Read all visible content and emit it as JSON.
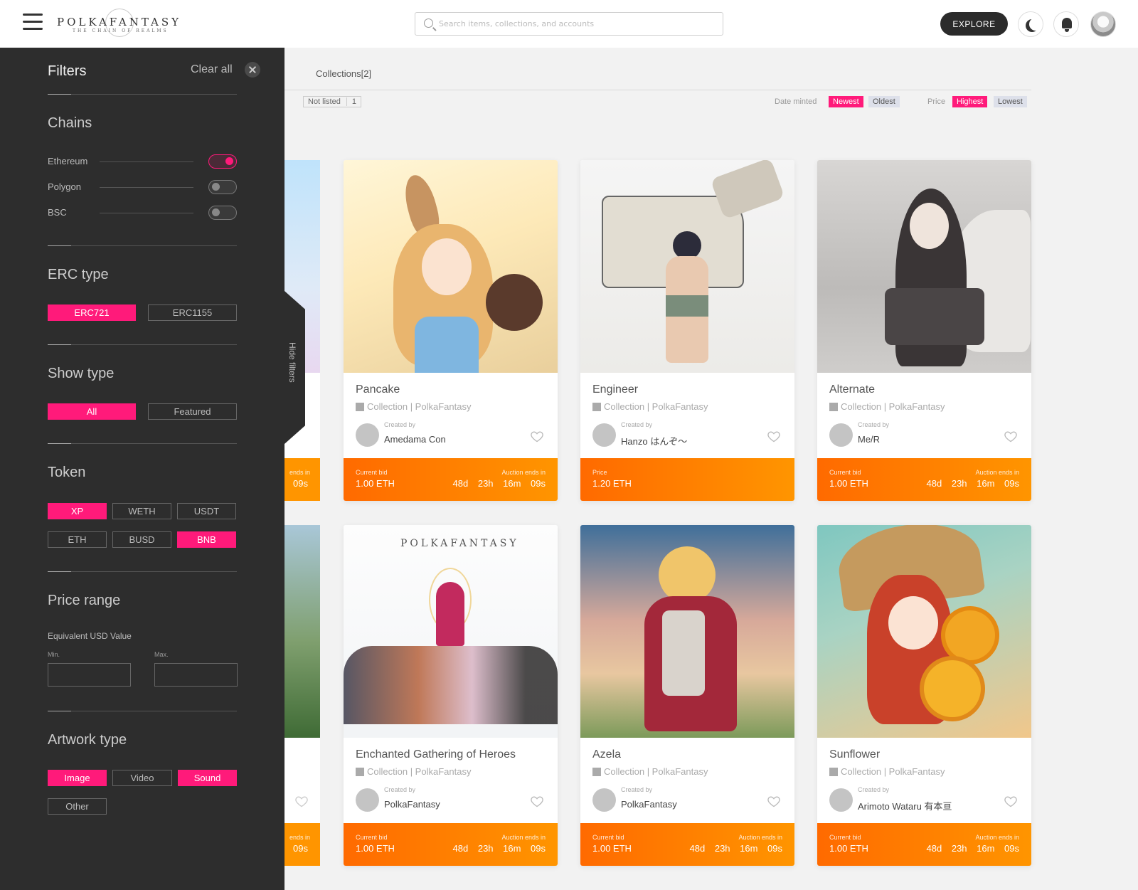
{
  "header": {
    "logo_main": "POLKAFANTASY",
    "logo_sub": "THE CHAIN OF REALMS",
    "search_placeholder": "Search items, collections, and accounts",
    "explore_label": "EXPLORE"
  },
  "sidebar": {
    "title": "Filters",
    "clear_all": "Clear all",
    "hide_filters": "Hide filters",
    "chains": {
      "title": "Chains",
      "items": [
        {
          "label": "Ethereum",
          "on": true
        },
        {
          "label": "Polygon",
          "on": false
        },
        {
          "label": "BSC",
          "on": false
        }
      ]
    },
    "erc": {
      "title": "ERC type",
      "options": [
        "ERC721",
        "ERC1155"
      ],
      "selected": "ERC721"
    },
    "show": {
      "title": "Show type",
      "options": [
        "All",
        "Featured"
      ],
      "selected": "All"
    },
    "token": {
      "title": "Token",
      "options": [
        "XP",
        "WETH",
        "USDT",
        "ETH",
        "BUSD",
        "BNB"
      ],
      "selected": [
        "XP",
        "BNB"
      ]
    },
    "price": {
      "title": "Price range",
      "subtitle": "Equivalent USD Value",
      "min_label": "Min.",
      "max_label": "Max.",
      "min_value": "",
      "max_value": ""
    },
    "artwork": {
      "title": "Artwork type",
      "options": [
        "Image",
        "Video",
        "Sound",
        "Other"
      ],
      "selected": [
        "Image",
        "Sound"
      ]
    }
  },
  "main": {
    "tab_collections": "Collections[2]",
    "tags": [
      {
        "label": "Not listed",
        "count": "1"
      }
    ],
    "sort": {
      "date_label": "Date minted",
      "date_options": [
        "Newest",
        "Oldest"
      ],
      "date_selected": "Newest",
      "price_label": "Price",
      "price_options": [
        "Highest",
        "Lowest"
      ],
      "price_selected": "Highest"
    }
  },
  "cards": [
    {
      "name": "Pancake",
      "collection": "Collection | PolkaFantasy",
      "created_by": "Created by",
      "creator": "Amedama Con",
      "bid_label": "Current bid",
      "bid_value": "1.00 ETH",
      "ends_label": "Auction ends in",
      "ends_value": "48d 23h 16m 09s"
    },
    {
      "name": "Engineer",
      "collection": "Collection | PolkaFantasy",
      "created_by": "Created by",
      "creator": "Hanzo はんぞ～",
      "bid_label": "Price",
      "bid_value": "1.20 ETH",
      "ends_label": "",
      "ends_value": ""
    },
    {
      "name": "Alternate",
      "collection": "Collection | PolkaFantasy",
      "created_by": "Created by",
      "creator": "Me/R",
      "bid_label": "Current bid",
      "bid_value": "1.00 ETH",
      "ends_label": "Auction ends in",
      "ends_value": "48d 23h 16m 09s"
    },
    {
      "name": "Enchanted Gathering of Heroes",
      "collection": "Collection | PolkaFantasy",
      "created_by": "Created by",
      "creator": "PolkaFantasy",
      "bid_label": "Current bid",
      "bid_value": "1.00 ETH",
      "ends_label": "Auction ends in",
      "ends_value": "48d 23h 16m 09s"
    },
    {
      "name": "Azela",
      "collection": "Collection | PolkaFantasy",
      "created_by": "Created by",
      "creator": "PolkaFantasy",
      "bid_label": "Current bid",
      "bid_value": "1.00 ETH",
      "ends_label": "Auction ends in",
      "ends_value": "48d 23h 16m 09s"
    },
    {
      "name": "Sunflower",
      "collection": "Collection | PolkaFantasy",
      "created_by": "Created by",
      "creator": "Arimoto Wataru 有本亘",
      "bid_label": "Current bid",
      "bid_value": "1.00 ETH",
      "ends_label": "Auction ends in",
      "ends_value": "48d 23h 16m 09s"
    }
  ],
  "ghost_cards": [
    {
      "ends_fragment": "ends in",
      "time_fragment": "09s"
    },
    {
      "ends_fragment": "ends in",
      "time_fragment": "09s"
    }
  ],
  "colors": {
    "accent": "#ff1a7a",
    "bid_start": "#ff6a00",
    "bid_end": "#ff9500",
    "sidebar": "#2d2d2d"
  }
}
